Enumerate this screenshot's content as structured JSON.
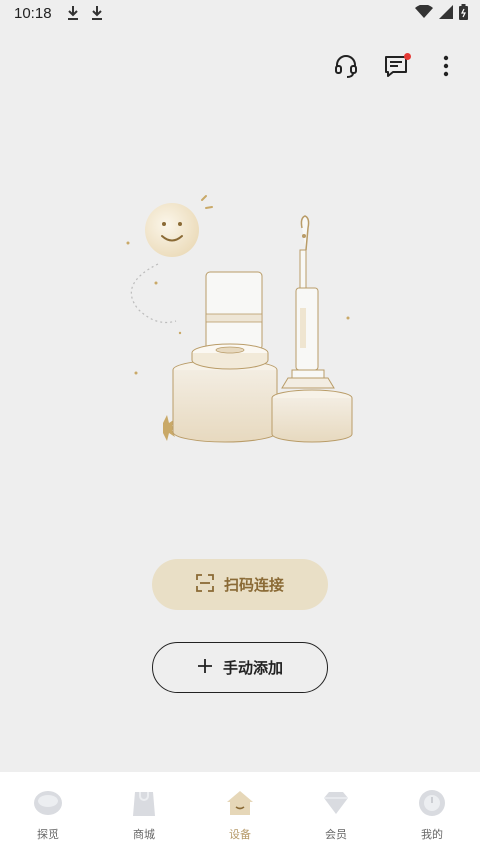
{
  "status_bar": {
    "time": "10:18"
  },
  "header": {
    "message_badge_color": "#e53935"
  },
  "colors": {
    "accent": "#b69a6a",
    "scan_bg": "#e9dfc6",
    "scan_text": "#8a6a35"
  },
  "actions": {
    "scan_label": "扫码连接",
    "manual_label": "手动添加"
  },
  "tabbar": {
    "tabs": [
      {
        "label": "探觅",
        "icon": "explore-icon",
        "active": false
      },
      {
        "label": "商城",
        "icon": "shop-icon",
        "active": false
      },
      {
        "label": "设备",
        "icon": "home-device-icon",
        "active": true
      },
      {
        "label": "会员",
        "icon": "member-diamond-icon",
        "active": false
      },
      {
        "label": "我的",
        "icon": "profile-icon",
        "active": false
      }
    ]
  }
}
